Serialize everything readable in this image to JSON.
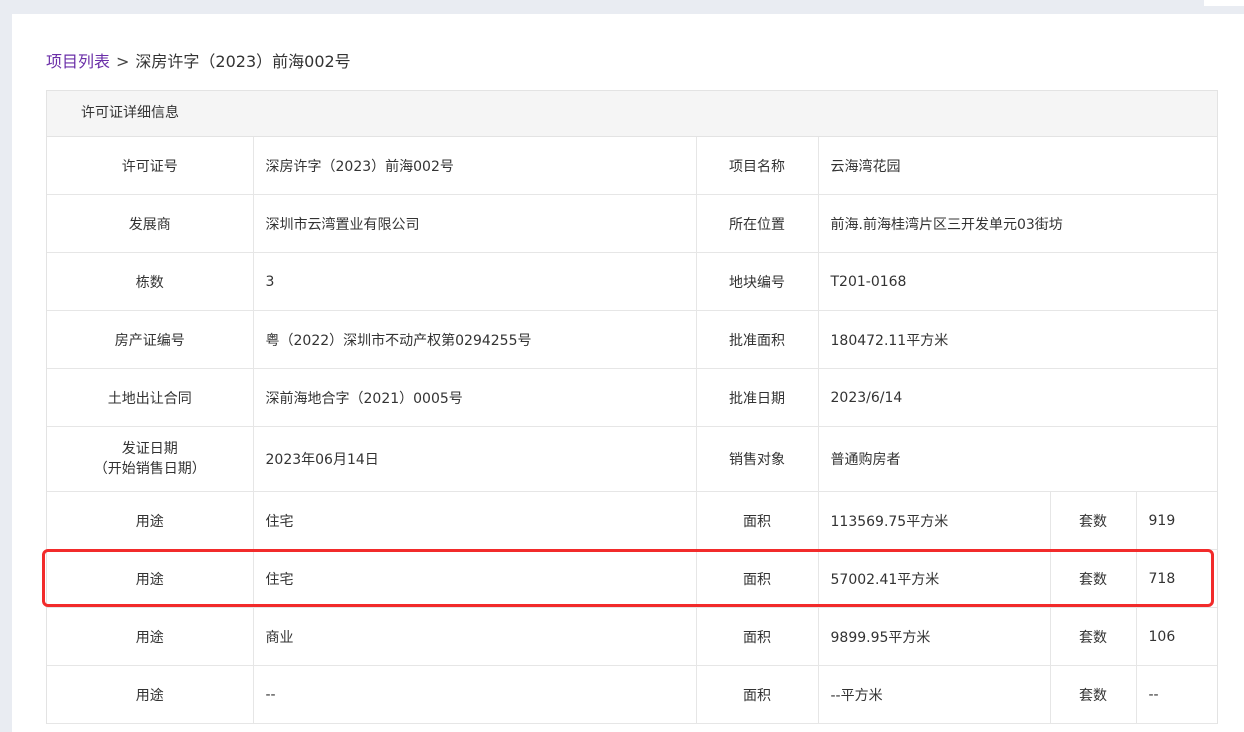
{
  "breadcrumb": {
    "root": "项目列表",
    "separator": ">",
    "current": "深房许字（2023）前海002号"
  },
  "panel": {
    "title": "许可证详细信息"
  },
  "details": [
    {
      "label_a": "许可证号",
      "value_a": "深房许字（2023）前海002号",
      "label_b": "项目名称",
      "value_b": "云海湾花园"
    },
    {
      "label_a": "发展商",
      "value_a": "深圳市云湾置业有限公司",
      "label_b": "所在位置",
      "value_b": "前海.前海桂湾片区三开发单元03街坊"
    },
    {
      "label_a": "栋数",
      "value_a": "3",
      "label_b": "地块编号",
      "value_b": "T201-0168"
    },
    {
      "label_a": "房产证编号",
      "value_a": "粤（2022）深圳市不动产权第0294255号",
      "label_b": "批准面积",
      "value_b": "180472.11平方米"
    },
    {
      "label_a": "土地出让合同",
      "value_a": "深前海地合字（2021）0005号",
      "label_b": "批准日期",
      "value_b": "2023/6/14"
    },
    {
      "label_a_line1": "发证日期",
      "label_a_line2": "（开始销售日期）",
      "value_a": "2023年06月14日",
      "label_b": "销售对象",
      "value_b": "普通购房者"
    }
  ],
  "usage": [
    {
      "use_label": "用途",
      "use": "住宅",
      "area_label": "面积",
      "area": "113569.75平方米",
      "count_label": "套数",
      "count": "919"
    },
    {
      "use_label": "用途",
      "use": "住宅",
      "area_label": "面积",
      "area": "57002.41平方米",
      "count_label": "套数",
      "count": "718"
    },
    {
      "use_label": "用途",
      "use": "商业",
      "area_label": "面积",
      "area": "9899.95平方米",
      "count_label": "套数",
      "count": "106"
    },
    {
      "use_label": "用途",
      "use": "--",
      "area_label": "面积",
      "area": "--平方米",
      "count_label": "套数",
      "count": "--"
    }
  ],
  "colors": {
    "link": "#6a2ea8",
    "highlight": "#f22b2b"
  }
}
